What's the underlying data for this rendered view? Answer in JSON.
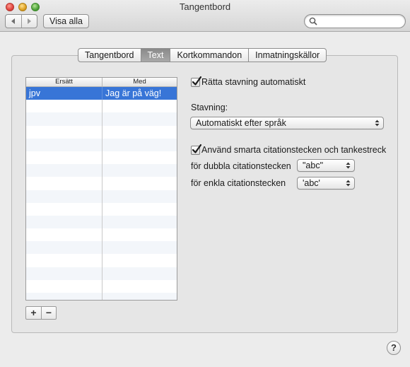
{
  "window": {
    "title": "Tangentbord"
  },
  "toolbar": {
    "show_all_label": "Visa alla",
    "search_placeholder": ""
  },
  "tabs": [
    {
      "label": "Tangentbord",
      "selected": false
    },
    {
      "label": "Text",
      "selected": true
    },
    {
      "label": "Kortkommandon",
      "selected": false
    },
    {
      "label": "Inmatningskällor",
      "selected": false
    }
  ],
  "table": {
    "headers": {
      "replace": "Ersätt",
      "with": "Med"
    },
    "rows": [
      {
        "replace": "jpv",
        "with": "Jag är på väg!",
        "selected": true
      }
    ]
  },
  "buttons": {
    "add": "+",
    "remove": "−"
  },
  "options": {
    "auto_spelling": {
      "label": "Rätta stavning automatiskt",
      "checked": true
    },
    "spelling_label": "Stavning:",
    "spelling_value": "Automatiskt efter språk",
    "smart_quotes": {
      "label": "Använd smarta citationstecken och tankestreck",
      "checked": true
    },
    "double_quotes_label": "för dubbla citationstecken",
    "double_quotes_value": "\"abc\"",
    "single_quotes_label": "för enkla citationstecken",
    "single_quotes_value": "'abc'"
  },
  "help_label": "?"
}
